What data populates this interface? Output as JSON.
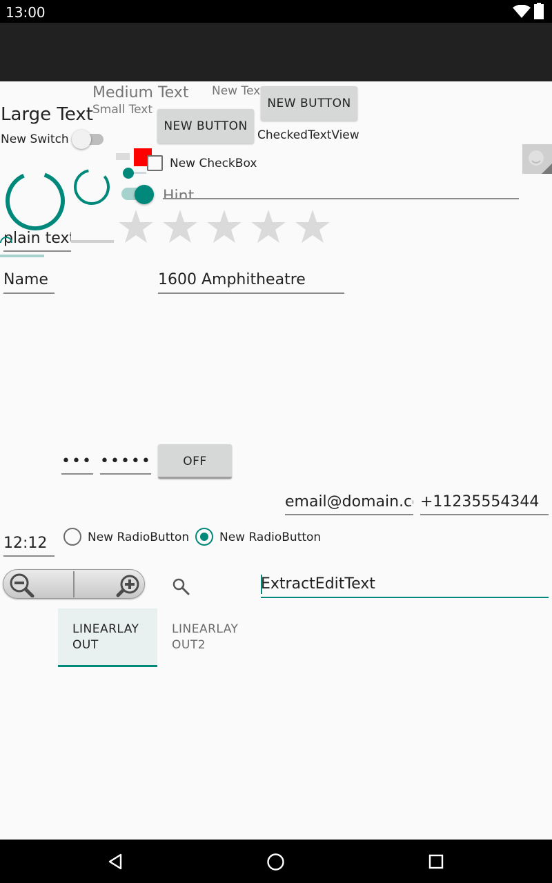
{
  "status_bar": {
    "time": "13:00",
    "wifi_icon": "wifi-icon",
    "battery_icon": "battery-icon"
  },
  "texts": {
    "large": "Large Text",
    "medium": "Medium Text",
    "small": "Small Text",
    "new_text": "New Text"
  },
  "buttons": {
    "new_button_1": "NEW BUTTON",
    "new_button_2": "NEW BUTTON",
    "toggle": "OFF"
  },
  "checked_text_view": "CheckedTextView",
  "switch_label": "New Switch",
  "checkbox_label": "New CheckBox",
  "edit_hint": "Hint",
  "edits": {
    "plain_text": "plain text",
    "name": "Name",
    "address": "1600 Amphitheatre",
    "password_1": "•••",
    "password_2": "•••••",
    "email": "email@domain.com",
    "phone": "+11235554344",
    "time": "12:12",
    "extract": "ExtractEditText"
  },
  "rating": {
    "stars": 5,
    "value": 0
  },
  "radio_buttons": [
    {
      "label": "New RadioButton",
      "checked": false
    },
    {
      "label": "New RadioButton",
      "checked": true
    }
  ],
  "tabs": [
    {
      "label": "LINEARLAYOUT",
      "selected": true
    },
    {
      "label": "LINEARLAYOUT2",
      "selected": false
    }
  ],
  "colors": {
    "accent": "#00897b",
    "status_bar": "#000000",
    "action_bar": "#212121",
    "background": "#fafafa",
    "red_box": "#ff0000"
  }
}
